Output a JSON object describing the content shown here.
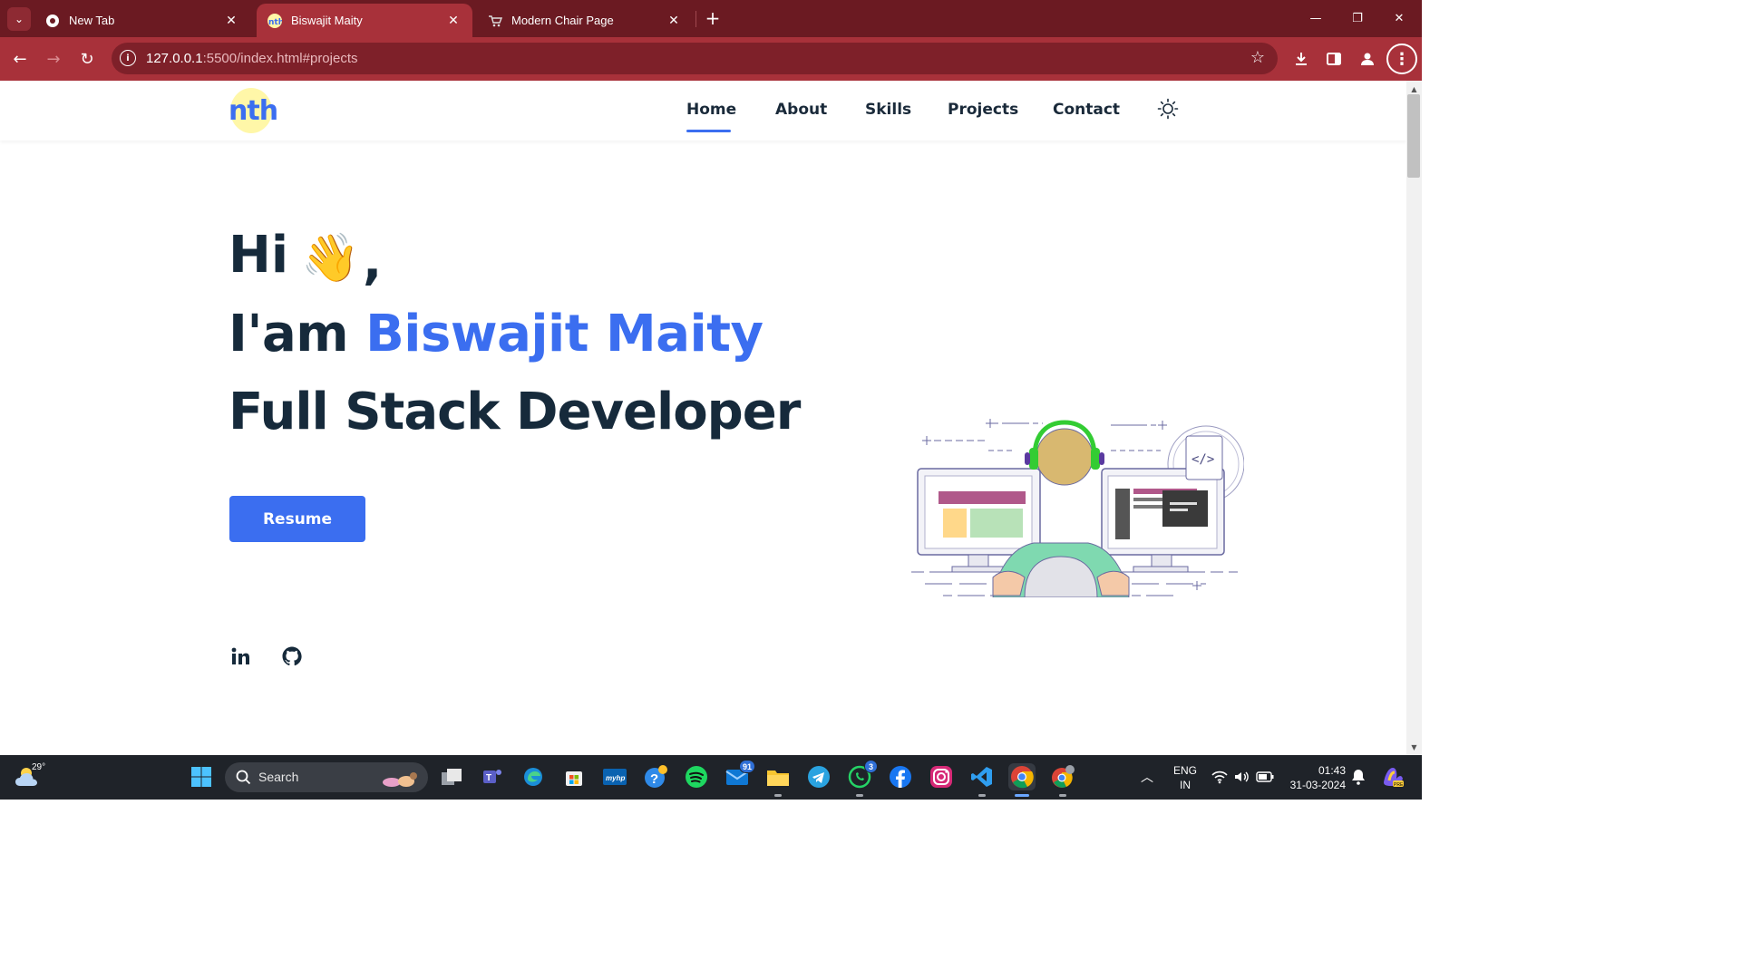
{
  "browser": {
    "tabs": [
      {
        "title": "New Tab",
        "active": false,
        "icon": "chrome-icon"
      },
      {
        "title": "Biswajit Maity",
        "active": true,
        "icon": "nth-favicon"
      },
      {
        "title": "Modern Chair Page",
        "active": false,
        "icon": "cart-favicon"
      }
    ],
    "url_host": "127.0.0.1",
    "url_rest": ":5500/index.html#projects"
  },
  "site": {
    "logo_text": "nth",
    "nav": [
      "Home",
      "About",
      "Skills",
      "Projects",
      "Contact"
    ],
    "active_nav": "Home",
    "hero": {
      "greeting": "Hi",
      "wave_emoji": "👋",
      "comma": ",",
      "intro_prefix": "I'am ",
      "name": "Biswajit Maity",
      "role": "Full Stack Developer",
      "resume_label": "Resume"
    },
    "socials": [
      "linkedin-icon",
      "github-icon"
    ],
    "colors": {
      "accent": "#3b6ef0",
      "heading": "#162a3b"
    }
  },
  "taskbar": {
    "weather_temp": "29°",
    "search_label": "Search",
    "apps": [
      {
        "name": "file-explorer-task-view",
        "badge": ""
      },
      {
        "name": "teams",
        "badge": ""
      },
      {
        "name": "edge",
        "badge": ""
      },
      {
        "name": "store",
        "badge": ""
      },
      {
        "name": "myhp",
        "badge": ""
      },
      {
        "name": "help",
        "badge": ""
      },
      {
        "name": "spotify",
        "badge": ""
      },
      {
        "name": "mail",
        "badge": "91"
      },
      {
        "name": "file-explorer",
        "badge": ""
      },
      {
        "name": "telegram",
        "badge": ""
      },
      {
        "name": "whatsapp",
        "badge": "3"
      },
      {
        "name": "facebook",
        "badge": ""
      },
      {
        "name": "instagram",
        "badge": ""
      },
      {
        "name": "vscode",
        "badge": ""
      },
      {
        "name": "chrome",
        "badge": ""
      },
      {
        "name": "chrome-profile",
        "badge": ""
      }
    ],
    "lang_line1": "ENG",
    "lang_line2": "IN",
    "time": "01:43",
    "date": "31-03-2024"
  }
}
